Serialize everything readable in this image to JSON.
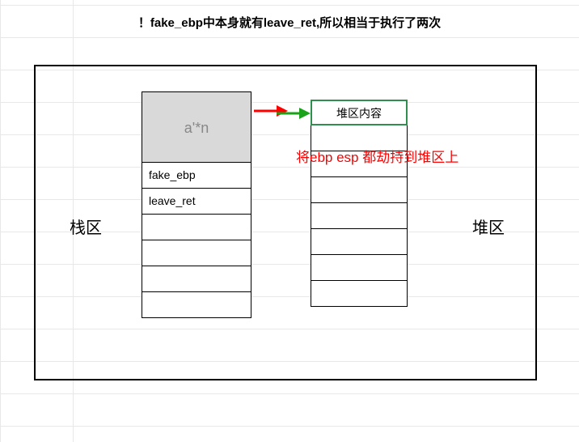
{
  "title": "！fake_ebp中本身就有leave_ret,所以相当于执行了两次",
  "stack_label": "栈区",
  "heap_label": "堆区",
  "annot": "将ebp esp 都劫持到堆区上",
  "stack": {
    "a_cell": "a'*n",
    "rows": [
      "fake_ebp",
      "leave_ret",
      "",
      "",
      "",
      ""
    ]
  },
  "heap": {
    "rows": [
      "堆区内容",
      "",
      "",
      "",
      "",
      "",
      "",
      ""
    ]
  },
  "icons": {
    "arrow_red": "arrow-right-icon",
    "arrow_green": "arrow-right-icon"
  }
}
